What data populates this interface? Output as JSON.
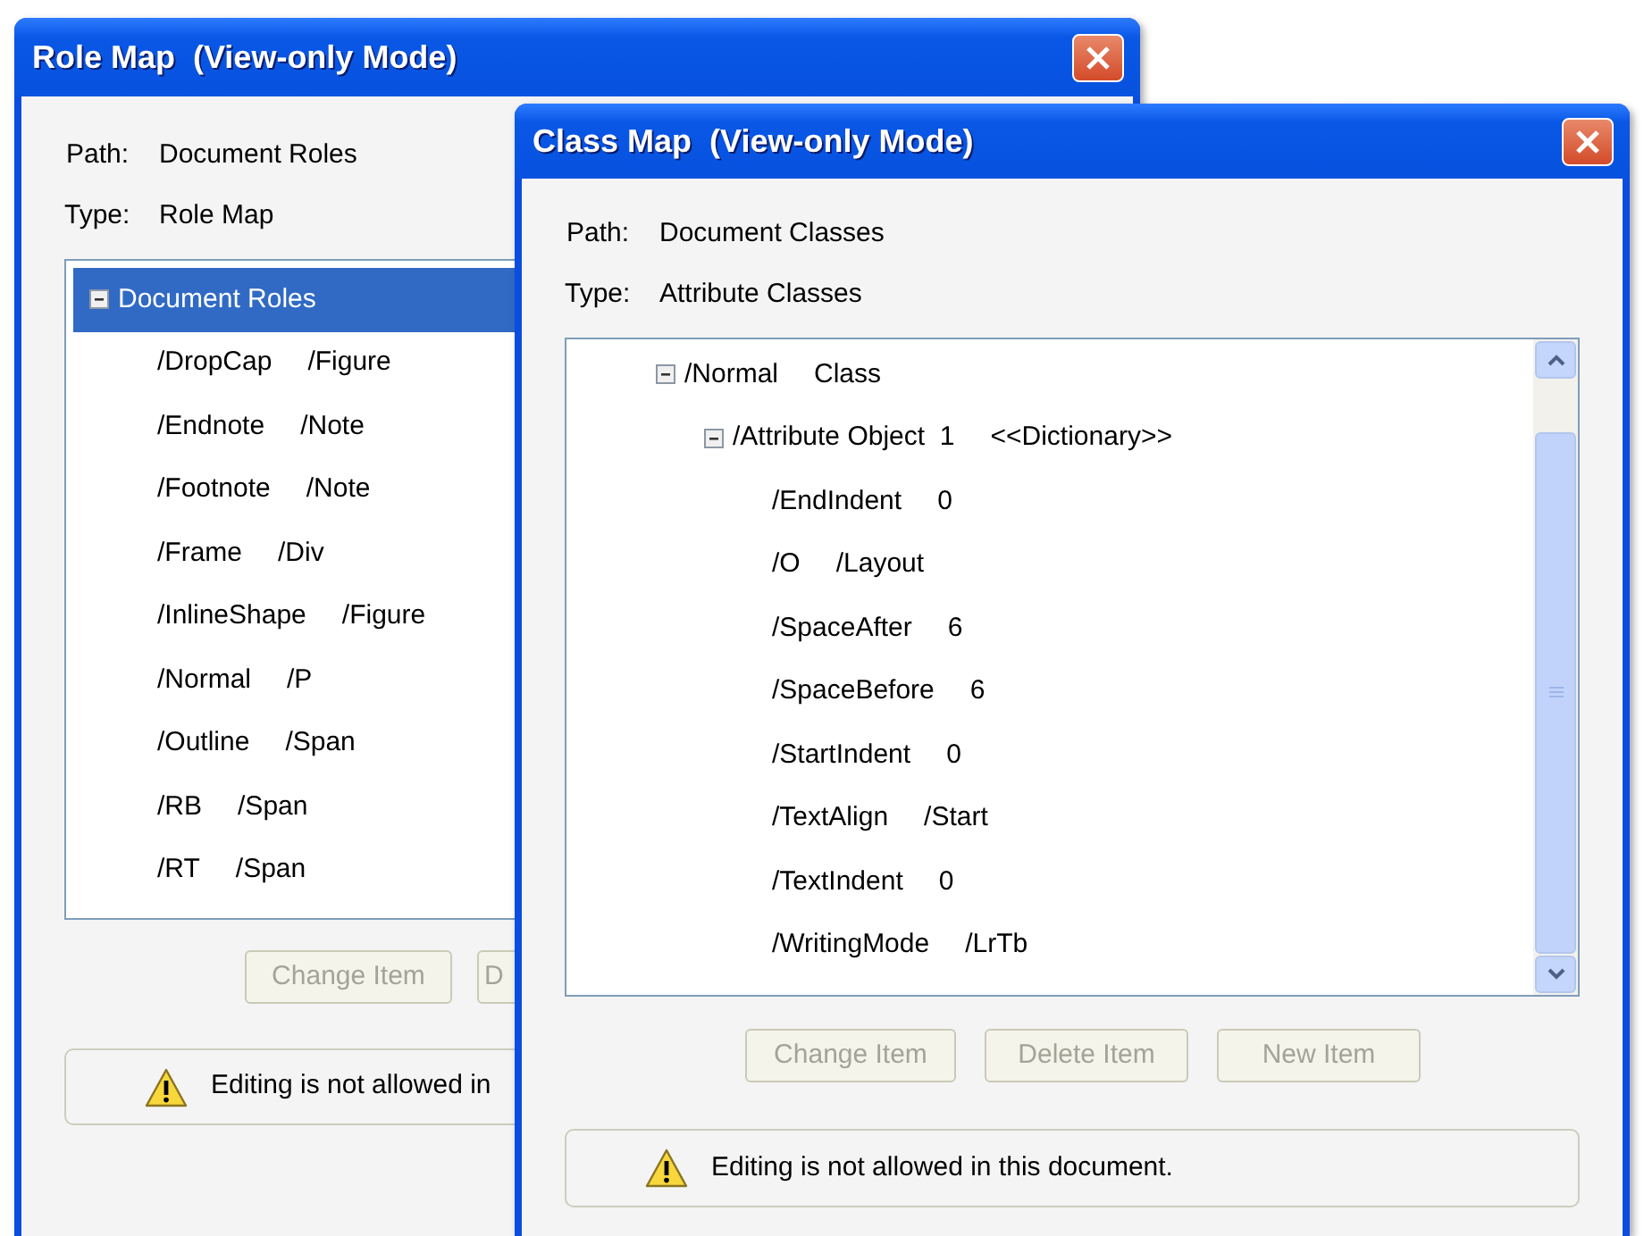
{
  "windows": [
    {
      "title": "Role Map  (View-only Mode)",
      "path_label": "Path:",
      "path": "Document Roles",
      "type_label": "Type:",
      "type": "Role Map",
      "tree": [
        {
          "name": "Document Roles",
          "expanded": true,
          "selected": true,
          "children": [
            {
              "name": "/DropCap",
              "value": "/Figure",
              "selected": false
            },
            {
              "name": "/Endnote",
              "value": "/Note",
              "selected": false
            },
            {
              "name": "/Footnote",
              "value": "/Note",
              "selected": false
            },
            {
              "name": "/Frame",
              "value": "/Div",
              "selected": false
            },
            {
              "name": "/InlineShape",
              "value": "/Figure",
              "selected": false
            },
            {
              "name": "/Normal",
              "value": "/P",
              "selected": false
            },
            {
              "name": "/Outline",
              "value": "/Span",
              "selected": false
            },
            {
              "name": "/RB",
              "value": "/Span",
              "selected": false
            },
            {
              "name": "/RT",
              "value": "/Span",
              "selected": false
            }
          ]
        }
      ],
      "buttons": [
        {
          "label": "Change Item",
          "disabled": true
        },
        {
          "label": "D",
          "disabled": true
        }
      ],
      "message": "Editing is not allowed in"
    },
    {
      "title": "Class Map  (View-only Mode)",
      "path_label": "Path:",
      "path": "Document Classes",
      "type_label": "Type:",
      "type": "Attribute Classes",
      "tree": [
        {
          "name": "/Normal",
          "value": "Class",
          "expanded": true,
          "selected": false,
          "children": [
            {
              "name": "/Attribute Object  1",
              "value": "<<Dictionary>>",
              "expanded": true,
              "selected": false,
              "children": [
                {
                  "name": "/EndIndent",
                  "value": "0",
                  "selected": false
                },
                {
                  "name": "/O",
                  "value": "/Layout",
                  "selected": false
                },
                {
                  "name": "/SpaceAfter",
                  "value": "6",
                  "selected": false
                },
                {
                  "name": "/SpaceBefore",
                  "value": "6",
                  "selected": false
                },
                {
                  "name": "/StartIndent",
                  "value": "0",
                  "selected": false
                },
                {
                  "name": "/TextAlign",
                  "value": "/Start",
                  "selected": false
                },
                {
                  "name": "/TextIndent",
                  "value": "0",
                  "selected": false
                },
                {
                  "name": "/WritingMode",
                  "value": "/LrTb",
                  "selected": false
                }
              ]
            }
          ]
        }
      ],
      "buttons": [
        {
          "label": "Change Item",
          "disabled": true
        },
        {
          "label": "Delete Item",
          "disabled": true
        },
        {
          "label": "New Item",
          "disabled": true
        }
      ],
      "message": "Editing is not allowed in this document."
    }
  ]
}
